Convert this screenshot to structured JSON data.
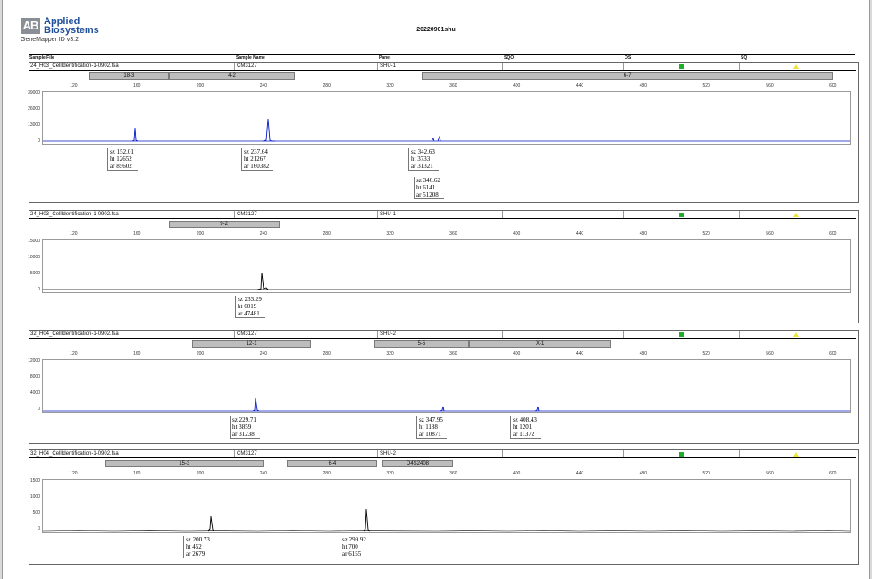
{
  "brand": {
    "mark": "AB",
    "line1": "Applied",
    "line2": "Biosystems",
    "product": "GeneMapper ID v3.2"
  },
  "report_title": "20220901shu",
  "columns": {
    "sample_file": "Sample File",
    "sample_name": "Sample Name",
    "panel": "Panel",
    "sqo": "SQO",
    "os": "OS",
    "sq": "SQ"
  },
  "colors": {
    "blue": "#0018c8",
    "black": "#000000",
    "green_flag": "#1fae2b",
    "yellow_flag": "#f0e23a"
  },
  "x_ticks": [
    "120",
    "160",
    "200",
    "240",
    "280",
    "320",
    "360",
    "400",
    "440",
    "480",
    "520",
    "560",
    "600"
  ],
  "panels": [
    {
      "sample_file": "24_H03_CellIdentification-1-0902.fsa",
      "sample_name": "CM3127",
      "panel": "SHU-1",
      "bins": [
        {
          "label": "18-3",
          "from": 130,
          "to": 180
        },
        {
          "label": "4-2",
          "from": 180,
          "to": 260
        },
        {
          "label": "6-7",
          "from": 340,
          "to": 600
        }
      ],
      "y_ticks": [
        "39000",
        "26000",
        "13000",
        "0"
      ],
      "peaks": [
        {
          "sz": "sz 152.01",
          "ht": "ht 12652",
          "ar": "ar 85602"
        },
        {
          "sz": "sz 237.64",
          "ht": "ht 21267",
          "ar": "ar 160382"
        },
        {
          "sz": "sz 342.63",
          "ht": "ht 3733",
          "ar": "ar 31321"
        },
        {
          "sz": "sz 346.62",
          "ht": "ht 6141",
          "ar": "ar 51208"
        }
      ]
    },
    {
      "sample_file": "24_H03_CellIdentification-1-0902.fsa",
      "sample_name": "CM3127",
      "panel": "SHU-1",
      "bins": [
        {
          "label": "9-2",
          "from": 180,
          "to": 250
        }
      ],
      "y_ticks": [
        "15000",
        "10000",
        "5000",
        "0"
      ],
      "peaks": [
        {
          "sz": "sz 233.29",
          "ht": "ht 6019",
          "ar": "ar 47481"
        }
      ]
    },
    {
      "sample_file": "32_H04_CellIdentification-1-0902.fsa",
      "sample_name": "CM3127",
      "panel": "SHU-2",
      "bins": [
        {
          "label": "12-1",
          "from": 195,
          "to": 270
        },
        {
          "label": "5-5",
          "from": 310,
          "to": 370
        },
        {
          "label": "X-1",
          "from": 370,
          "to": 460
        }
      ],
      "y_ticks": [
        "12000",
        "8000",
        "4000",
        "0"
      ],
      "peaks": [
        {
          "sz": "sz 229.71",
          "ht": "ht 3859",
          "ar": "ar 31238"
        },
        {
          "sz": "sz 347.95",
          "ht": "ht 1188",
          "ar": "ar 10871"
        },
        {
          "sz": "sz 408.43",
          "ht": "ht 1201",
          "ar": "ar 11372"
        }
      ]
    },
    {
      "sample_file": "32_H04_CellIdentification-1-0902.fsa",
      "sample_name": "CM3127",
      "panel": "SHU-2",
      "bins": [
        {
          "label": "15-3",
          "from": 140,
          "to": 240
        },
        {
          "label": "6-4",
          "from": 255,
          "to": 312
        },
        {
          "label": "D4S2408",
          "from": 315,
          "to": 360
        }
      ],
      "y_ticks": [
        "1500",
        "1000",
        "500",
        "0"
      ],
      "peaks": [
        {
          "sz": "sz 200.73",
          "ht": "ht 452",
          "ar": "ar 2679"
        },
        {
          "sz": "sz 299.92",
          "ht": "ht 700",
          "ar": "ar 6155"
        }
      ]
    }
  ]
}
